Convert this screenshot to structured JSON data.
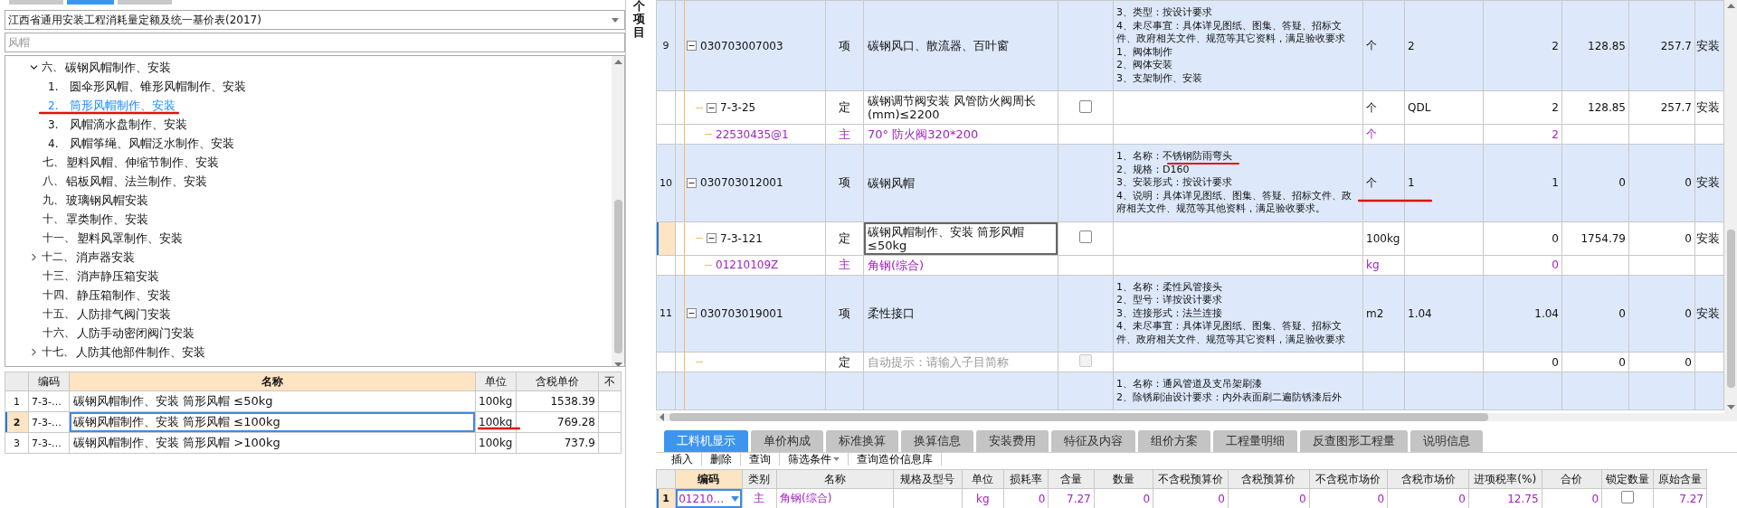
{
  "top_tabs": [
    {
      "selected": false
    },
    {
      "selected": true
    },
    {
      "selected": false
    }
  ],
  "library_select": {
    "value": "江西省通用安装工程消耗量定额及统一基价表(2017)"
  },
  "search": {
    "placeholder": "风帽"
  },
  "tree": [
    {
      "number": "六、",
      "label": "碳钢风帽制作、安装",
      "expanded": true,
      "selected": false,
      "children": [
        {
          "number": "1.",
          "label": "圆伞形风帽、锥形风帽制作、安装",
          "selected": false
        },
        {
          "number": "2.",
          "label": "筒形风帽制作、安装",
          "selected": true
        },
        {
          "number": "3.",
          "label": "风帽滴水盘制作、安装",
          "selected": false
        },
        {
          "number": "4.",
          "label": "风帽筝绳、风帽泛水制作、安装",
          "selected": false
        }
      ]
    },
    {
      "number": "七、",
      "label": "塑料风帽、伸缩节制作、安装",
      "selected": false
    },
    {
      "number": "八、",
      "label": "铝板风帽、法兰制作、安装",
      "selected": false
    },
    {
      "number": "九、",
      "label": "玻璃钢风帽安装",
      "selected": false
    },
    {
      "number": "十、",
      "label": "罩类制作、安装",
      "selected": false
    },
    {
      "number": "十一、",
      "label": "塑料风罩制作、安装",
      "selected": false
    },
    {
      "number": "十二、",
      "label": "消声器安装",
      "expanded": false,
      "selected": false
    },
    {
      "number": "十三、",
      "label": "消声静压箱安装",
      "selected": false
    },
    {
      "number": "十四、",
      "label": "静压箱制作、安装",
      "selected": false
    },
    {
      "number": "十五、",
      "label": "人防排气阀门安装",
      "selected": false
    },
    {
      "number": "十六、",
      "label": "人防手动密闭阀门安装",
      "selected": false
    },
    {
      "number": "十七、",
      "label": "人防其他部件制作、安装",
      "expanded": false,
      "selected": false
    }
  ],
  "quota_table": {
    "columns": [
      "编码",
      "名称",
      "单位",
      "含税单价",
      "不"
    ],
    "rows": [
      {
        "number": "1",
        "code": "7-3-…",
        "name": "碳钢风帽制作、安装 筒形风帽 ≤50kg",
        "unit": "100kg",
        "price": "1538.39",
        "selected": false
      },
      {
        "number": "2",
        "code": "7-3-…",
        "name": "碳钢风帽制作、安装 筒形风帽 ≤100kg",
        "unit": "100kg",
        "price": "769.28",
        "selected": true
      },
      {
        "number": "3",
        "code": "7-3-…",
        "name": "碳钢风帽制作、安装 筒形风帽 >100kg",
        "unit": "100kg",
        "price": "737.9",
        "selected": false
      }
    ]
  },
  "side_label": "个项目",
  "main_table": {
    "rows": [
      {
        "kind": "item",
        "number": "9",
        "code": "030703007003",
        "type": "项",
        "name": "碳钢风口、散流器、百叶窗",
        "features": [
          "3、类型：按设计要求",
          "4、未尽事宜：具体详见图纸、图集、答疑、招标文件、政府相关文件、规范等其它资料，满足验收要求",
          "1、阀体制作",
          "2、阀体安装",
          "3、支架制作、安装"
        ],
        "unit": "个",
        "expr": "2",
        "qty": "2",
        "price": "128.85",
        "total": "257.7",
        "extra": "安装",
        "expanded": true,
        "selected": false,
        "children": [
          {
            "kind": "quota",
            "code": "7-3-25",
            "type": "定",
            "name": "碳钢调节阀安装 风管防火阀周长(mm)≤2200",
            "checked": false,
            "disabled": false,
            "unit": "个",
            "expr": "QDL",
            "qty": "2",
            "price": "128.85",
            "total": "257.7",
            "extra": "安装",
            "expanded": true,
            "selected": false,
            "children": [
              {
                "kind": "material",
                "code": "22530435@1",
                "type": "主",
                "name": "70° 防火阀320*200",
                "unit": "个",
                "qty": "2",
                "selected": false
              }
            ]
          }
        ]
      },
      {
        "kind": "item",
        "number": "10",
        "code": "030703012001",
        "type": "项",
        "name": "碳钢风帽",
        "features": [
          "1、名称：不锈钢防雨弯头",
          "2、规格：D160",
          "3、安装形式：按设计要求",
          "4、说明：具体详见图纸、图集、答疑、招标文件、政府相关文件、规范等其他资料，满足验收要求。"
        ],
        "unit": "个",
        "expr": "1",
        "qty": "1",
        "price": "0",
        "total": "0",
        "extra": "安装",
        "expanded": true,
        "selected": false,
        "children": [
          {
            "kind": "quota",
            "code": "7-3-121",
            "type": "定",
            "name": "碳钢风帽制作、安装 筒形风帽 ≤50kg",
            "checked": false,
            "disabled": false,
            "unit": "100kg",
            "qty": "0",
            "price": "1754.79",
            "total": "0",
            "extra": "安装",
            "expanded": true,
            "selected": true,
            "children": [
              {
                "kind": "material",
                "code": "01210109Z",
                "type": "主",
                "name": "角钢(综合)",
                "unit": "kg",
                "qty": "0",
                "selected": false
              }
            ]
          }
        ]
      },
      {
        "kind": "item",
        "number": "11",
        "code": "030703019001",
        "type": "项",
        "name": "柔性接口",
        "features": [
          "1、名称：柔性风管接头",
          "2、型号：详按设计要求",
          "3、连接形式：法兰连接",
          "4、未尽事宜：具体详见图纸、图集、答疑、招标文件、政府相关文件、规范等其它资料，满足验收要求"
        ],
        "unit": "m2",
        "expr": "1.04",
        "qty": "1.04",
        "price": "0",
        "total": "0",
        "extra": "安装",
        "expanded": true,
        "selected": false,
        "children": [
          {
            "kind": "quota",
            "type": "定",
            "placeholder": "自动提示：请输入子目简称",
            "checked": false,
            "disabled": true,
            "qty": "0",
            "price": "0",
            "total": "0",
            "selected": false
          }
        ]
      },
      {
        "kind": "item",
        "features": [
          "1、名称：通风管道及支吊架刷漆",
          "2、除锈刷油设计要求：内外表面刷二遍防锈漆后外"
        ],
        "selected": false
      }
    ]
  },
  "detail_tabs": [
    {
      "label": "工料机显示",
      "selected": true
    },
    {
      "label": "单价构成",
      "selected": false
    },
    {
      "label": "标准换算",
      "selected": false
    },
    {
      "label": "换算信息",
      "selected": false
    },
    {
      "label": "安装费用",
      "selected": false
    },
    {
      "label": "特征及内容",
      "selected": false
    },
    {
      "label": "组价方案",
      "selected": false
    },
    {
      "label": "工程量明细",
      "selected": false
    },
    {
      "label": "反查图形工程量",
      "selected": false
    },
    {
      "label": "说明信息",
      "selected": false
    }
  ],
  "toolbar": [
    {
      "label": "插入",
      "has_menu": false
    },
    {
      "label": "删除",
      "has_menu": false
    },
    {
      "label": "查询",
      "has_menu": false
    },
    {
      "label": "筛选条件",
      "has_menu": true
    },
    {
      "label": "查询造价信息库",
      "has_menu": false
    }
  ],
  "resource_table": {
    "columns": [
      "编码",
      "类别",
      "名称",
      "规格及型号",
      "单位",
      "损耗率",
      "含量",
      "数量",
      "不含税预算价",
      "含税预算价",
      "不含税市场价",
      "含税市场价",
      "进项税率(%)",
      "合价",
      "锁定数量",
      "原始含量"
    ],
    "rows": [
      {
        "number": "1",
        "code": "01210…",
        "type": "主",
        "name": "角钢(综合)",
        "unit": "kg",
        "loss": "0",
        "content": "7.27",
        "qty": "0",
        "pre_budget": "0",
        "budget": "0",
        "pre_market": "0",
        "market": "0",
        "tax_rate": "12.75",
        "total": "0",
        "locked": false,
        "original": "7.27",
        "selected": true
      }
    ]
  }
}
